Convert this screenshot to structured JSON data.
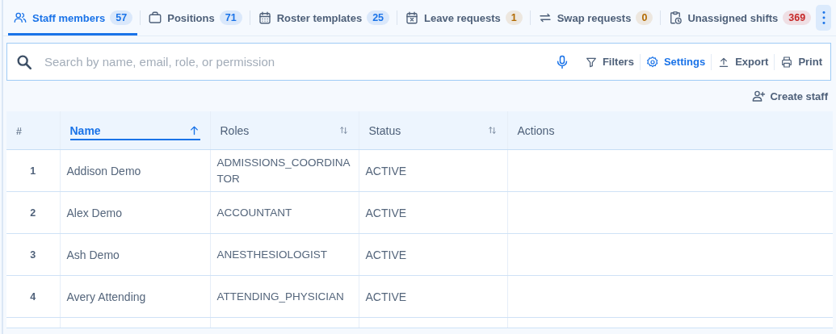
{
  "tabs": [
    {
      "label": "Staff members",
      "count": "57",
      "color": "#1a73e8",
      "selected": true
    },
    {
      "label": "Positions",
      "count": "71",
      "color": "#1a73e8",
      "selected": false
    },
    {
      "label": "Roster templates",
      "count": "25",
      "color": "#1a73e8",
      "selected": false
    },
    {
      "label": "Leave requests",
      "count": "1",
      "color": "#b26a00",
      "selected": false
    },
    {
      "label": "Swap requests",
      "count": "0",
      "color": "#b26a00",
      "selected": false
    },
    {
      "label": "Unassigned shifts",
      "count": "369",
      "color": "#c62828",
      "selected": false
    }
  ],
  "search": {
    "placeholder": "Search by name, email, role, or permission"
  },
  "toolbar": [
    {
      "label": "Filters",
      "active": false
    },
    {
      "label": "Settings",
      "active": true
    },
    {
      "label": "Export",
      "active": false
    },
    {
      "label": "Print",
      "active": false
    }
  ],
  "create_button": "Create staff",
  "table": {
    "columns": [
      {
        "label": "#",
        "kind": "index"
      },
      {
        "label": "Name",
        "kind": "sortable",
        "sorted": true
      },
      {
        "label": "Roles",
        "kind": "sortable",
        "sorted": false
      },
      {
        "label": "Status",
        "kind": "sortable",
        "sorted": false
      },
      {
        "label": "Actions",
        "kind": "plain"
      }
    ],
    "rows": [
      {
        "index": "1",
        "name": "Addison Demo",
        "role": "ADMISSIONS_COORDINATOR",
        "status": "ACTIVE"
      },
      {
        "index": "2",
        "name": "Alex Demo",
        "role": "ACCOUNTANT",
        "status": "ACTIVE"
      },
      {
        "index": "3",
        "name": "Ash Demo",
        "role": "ANESTHESIOLOGIST",
        "status": "ACTIVE"
      },
      {
        "index": "4",
        "name": "Avery Attending",
        "role": "ATTENDING_PHYSICIAN",
        "status": "ACTIVE"
      }
    ]
  }
}
